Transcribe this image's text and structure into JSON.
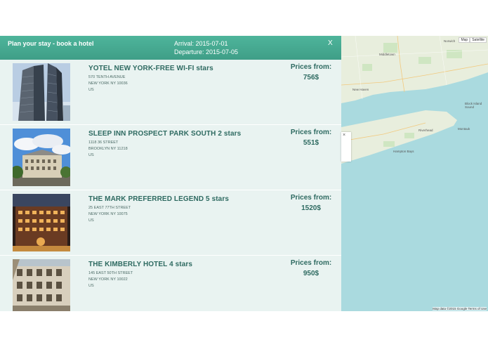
{
  "header": {
    "title": "Plan your stay - book a hotel",
    "arrival": "Arrival: 2015-07-01",
    "departure": "Departure: 2015-07-05",
    "close": "X"
  },
  "hotels": [
    {
      "name": "YOTEL NEW YORK-FREE WI-FI stars",
      "street": "570 TENTH AVENUE",
      "city": "NEW YORK NY 10036",
      "country": "US",
      "price_label": "Prices from:",
      "price": "756$"
    },
    {
      "name": "SLEEP INN PROSPECT PARK SOUTH 2 stars",
      "street": "1118 36 STREET",
      "city": "BROOKLYN NY 11218",
      "country": "US",
      "price_label": "Prices from:",
      "price": "551$"
    },
    {
      "name": "THE MARK PREFERRED LEGEND 5 stars",
      "street": "25 EAST 77TH STREET",
      "city": "NEW YORK NY 10075",
      "country": "US",
      "price_label": "Prices from:",
      "price": "1520$"
    },
    {
      "name": "THE KIMBERLY HOTEL 4 stars",
      "street": "145 EAST 50TH STREET",
      "city": "NEW YORK NY 10022",
      "country": "US",
      "price_label": "Prices from:",
      "price": "950$"
    }
  ],
  "map": {
    "btn_map": "Map",
    "btn_satellite": "Satellite",
    "footer": "Map data ©2015 Google   Terms of Use",
    "infowindow_close": "×",
    "labels": [
      "Middletown",
      "Norwich",
      "New Haven",
      "Block Island Sound",
      "Montauk",
      "Hampton Bays",
      "Riverhead"
    ]
  },
  "colors": {
    "header": "#45a88f",
    "panel": "#e9f3f1",
    "text": "#2e6a61",
    "water": "#aadadf",
    "land": "#e8eedd"
  }
}
